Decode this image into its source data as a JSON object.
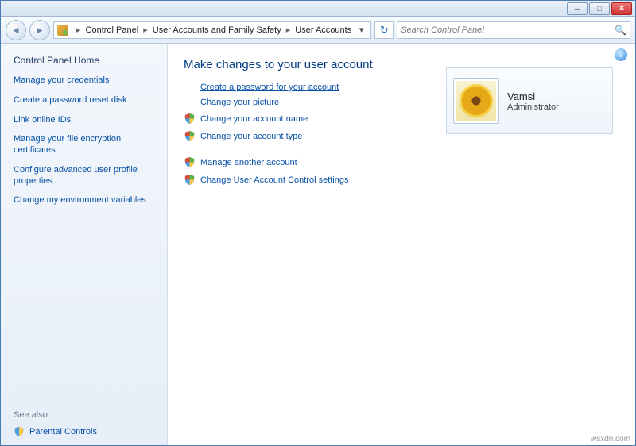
{
  "breadcrumb": {
    "items": [
      "Control Panel",
      "User Accounts and Family Safety",
      "User Accounts"
    ]
  },
  "search": {
    "placeholder": "Search Control Panel"
  },
  "sidebar": {
    "home": "Control Panel Home",
    "tasks": [
      "Manage your credentials",
      "Create a password reset disk",
      "Link online IDs",
      "Manage your file encryption certificates",
      "Configure advanced user profile properties",
      "Change my environment variables"
    ],
    "seealso_label": "See also",
    "parental": "Parental Controls"
  },
  "content": {
    "heading": "Make changes to your user account",
    "group1": [
      {
        "label": "Create a password for your account",
        "shield": false,
        "highlight": true
      },
      {
        "label": "Change your picture",
        "shield": false,
        "highlight": false
      },
      {
        "label": "Change your account name",
        "shield": true,
        "highlight": false
      },
      {
        "label": "Change your account type",
        "shield": true,
        "highlight": false
      }
    ],
    "group2": [
      {
        "label": "Manage another account",
        "shield": true
      },
      {
        "label": "Change User Account Control settings",
        "shield": true
      }
    ]
  },
  "user": {
    "name": "Vamsi",
    "role": "Administrator"
  },
  "watermark": "wsxdn.com"
}
